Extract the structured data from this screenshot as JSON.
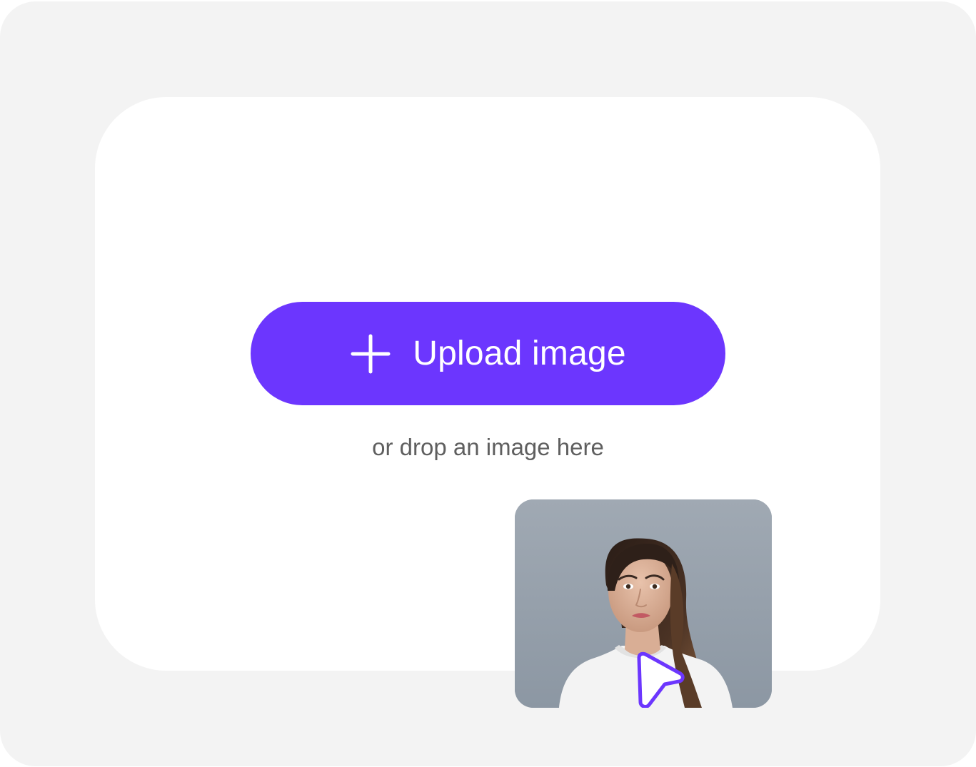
{
  "upload": {
    "button_label": "Upload image",
    "plus_icon": "plus-icon",
    "hint": "or drop an image here"
  },
  "dragged_image": {
    "subject": "photo",
    "cursor_icon": "pointer-cursor-icon"
  },
  "colors": {
    "accent": "#6c36fe",
    "frame_bg": "#f3f3f3",
    "dropzone_bg": "#ffffff",
    "hint_text": "#5f5f5f",
    "photo_bg": "#929ca7"
  }
}
